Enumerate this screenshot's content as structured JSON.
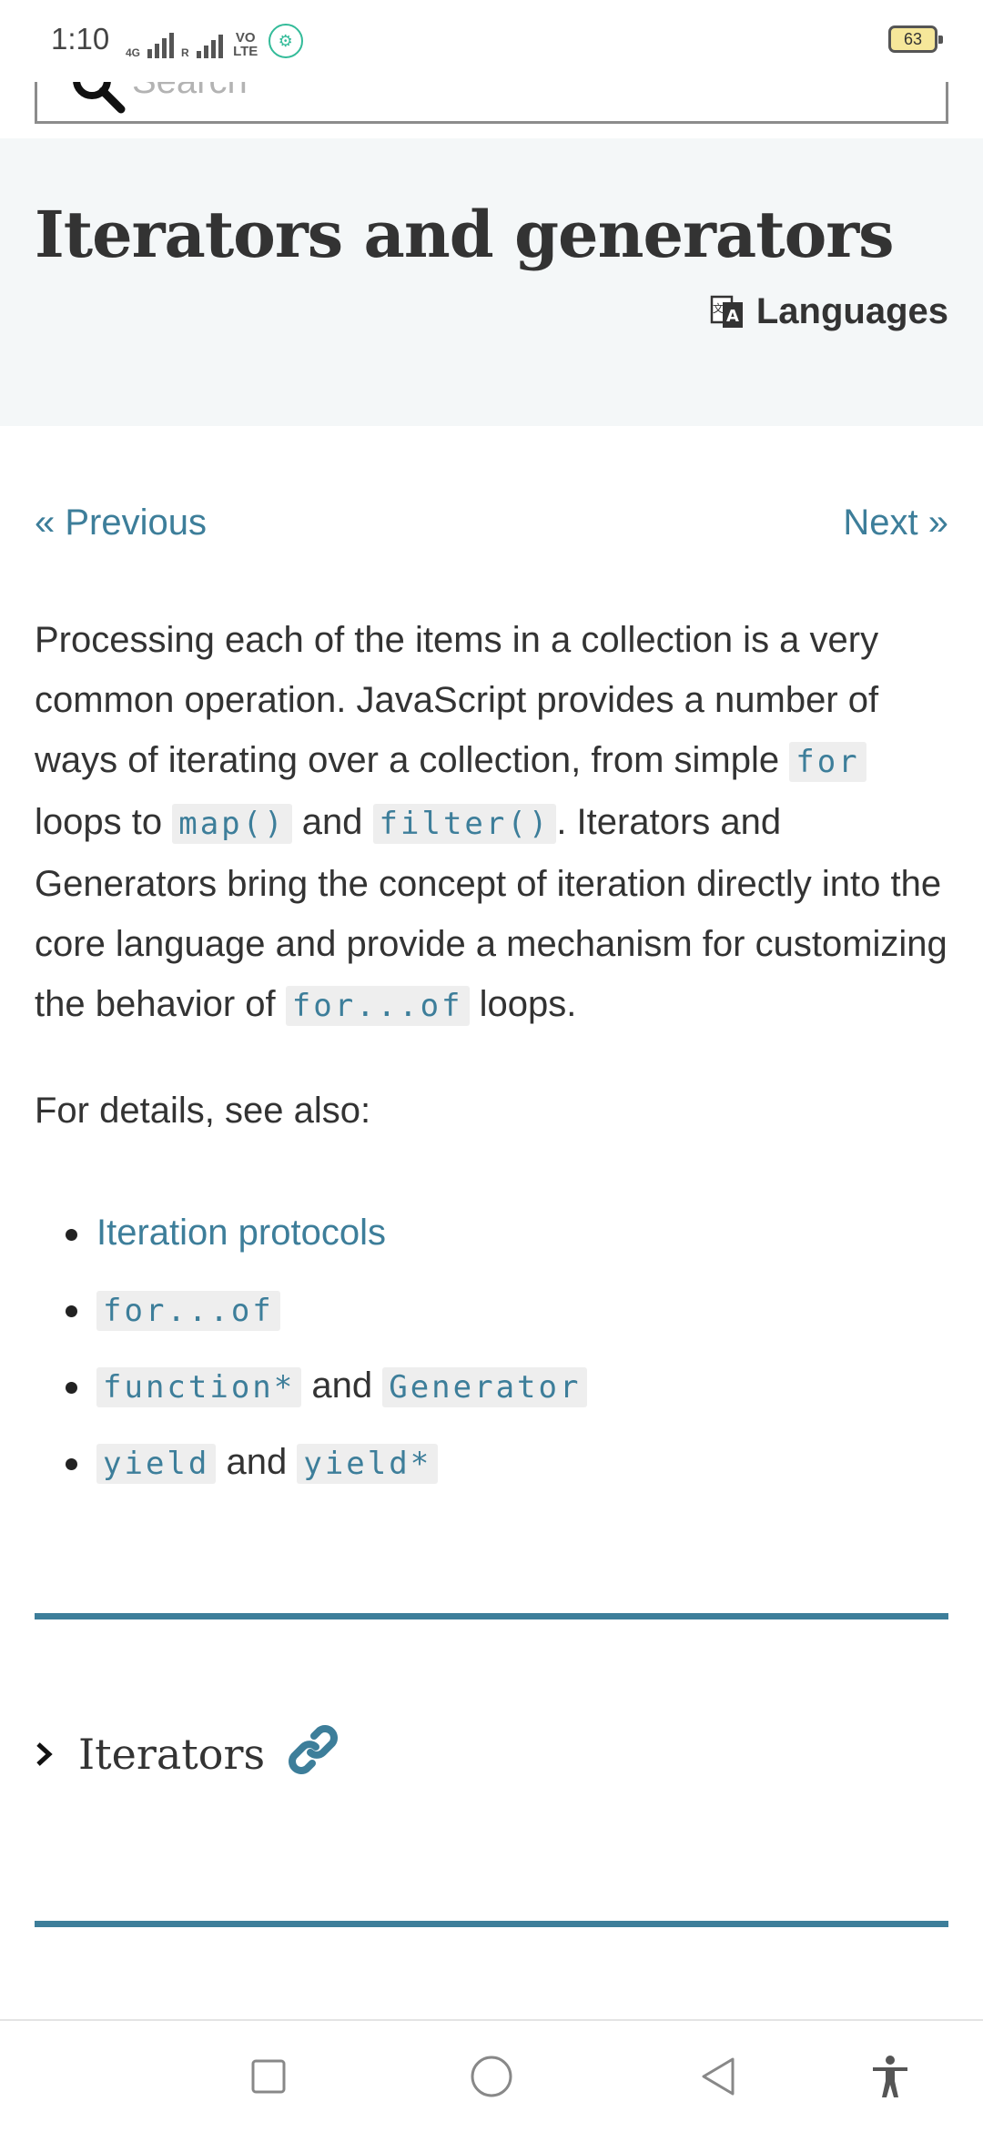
{
  "status_bar": {
    "time": "1:10",
    "network_1": "4G",
    "network_2": "R",
    "volte": "VO LTE",
    "battery": "63"
  },
  "search": {
    "placeholder": "Search"
  },
  "header": {
    "title": "Iterators and generators",
    "languages_label": "Languages"
  },
  "nav": {
    "previous": "« Previous",
    "next": "Next »"
  },
  "intro": {
    "t1": "Processing each of the items in a collection is a very common operation. JavaScript provides a number of ways of iterating over a collection, from simple ",
    "c1": "for",
    "t2": " loops to ",
    "c2": "map()",
    "t3": " and ",
    "c3": "filter()",
    "t4": ". Iterators and Generators bring the concept of iteration directly into the core language and provide a mechanism for customizing the behavior of ",
    "c4": "for...of",
    "t5": " loops."
  },
  "details_label": "For details, see also:",
  "see_also": {
    "item1": "Iteration protocols",
    "item2": "for...of",
    "item3_code1": "function*",
    "item3_and": "and",
    "item3_code2": "Generator",
    "item4_code1": "yield",
    "item4_and": "and",
    "item4_code2": "yield*"
  },
  "section": {
    "title": "Iterators"
  },
  "colors": {
    "accent": "#3d7e9a",
    "header_bg": "#f4f7f8",
    "text": "#333333"
  }
}
